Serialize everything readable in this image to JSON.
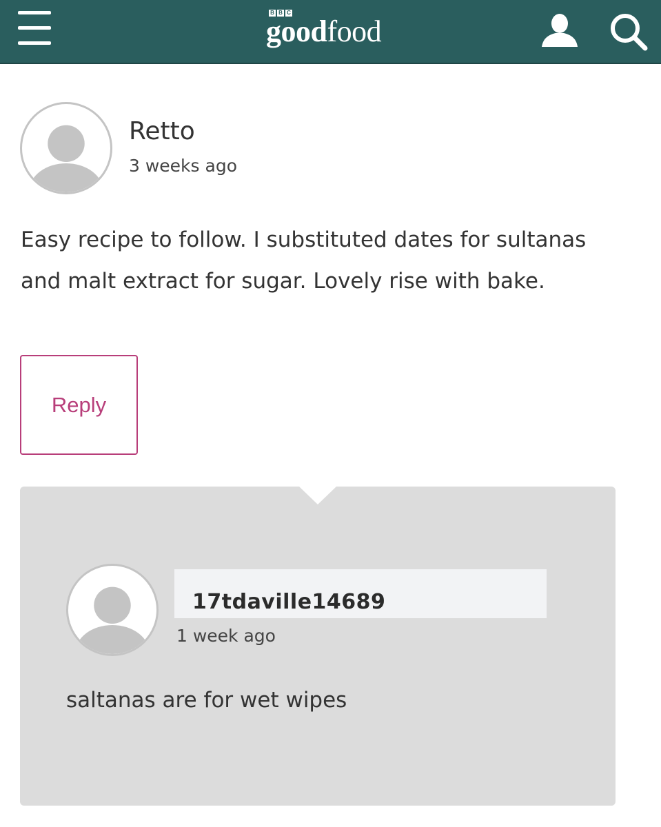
{
  "header": {
    "logo_bbc_letters": [
      "B",
      "B",
      "C"
    ],
    "logo_word_bold": "good",
    "logo_word_light": "food",
    "menu_icon": "hamburger-menu-icon",
    "account_icon": "user-account-icon",
    "search_icon": "search-icon",
    "background_color": "#2a5e5e"
  },
  "comment": {
    "author": "Retto",
    "time": "3 weeks ago",
    "body": "Easy recipe to follow. I substituted dates for sultanas and malt extract for sugar. Lovely rise with bake.",
    "reply_label": "Reply",
    "accent_color": "#b83e7a"
  },
  "reply": {
    "author": "17tdaville14689",
    "time": "1 week ago",
    "body": "saltanas are for wet wipes",
    "background_color": "#dcdcdc"
  }
}
